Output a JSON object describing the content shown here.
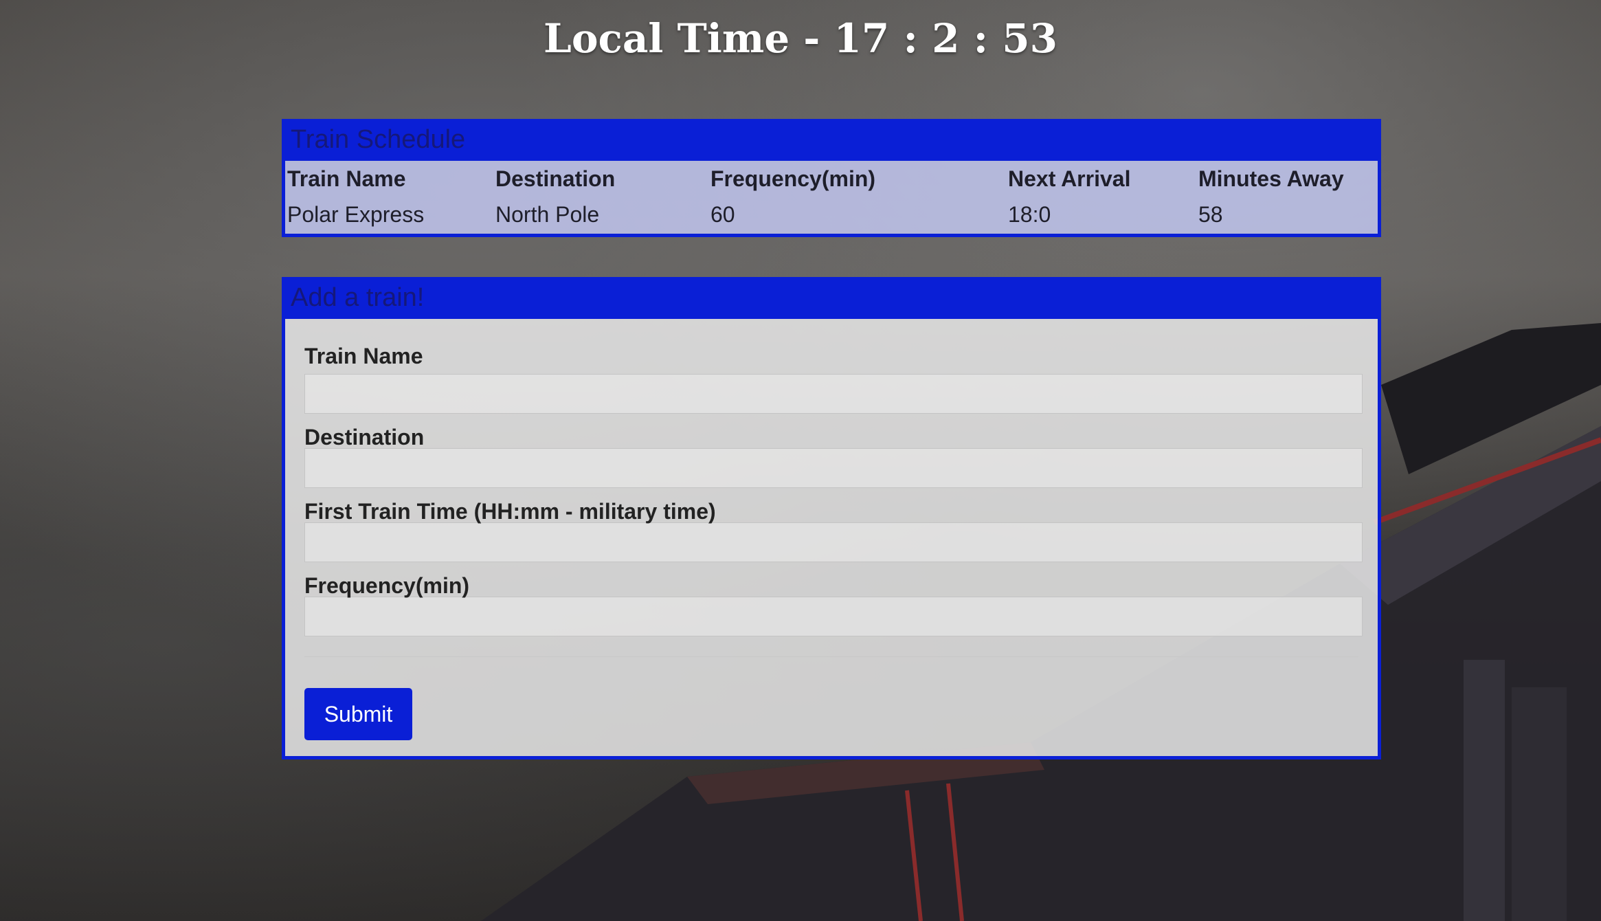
{
  "clock": {
    "text": "Local Time - 17 : 2 : 53"
  },
  "schedule": {
    "heading": "Train Schedule",
    "columns": [
      "Train Name",
      "Destination",
      "Frequency(min)",
      "Next Arrival",
      "Minutes Away"
    ],
    "rows": [
      [
        "Polar Express",
        "North Pole",
        "60",
        "18:0",
        "58"
      ]
    ]
  },
  "add_train": {
    "heading": "Add a train!",
    "fields": {
      "train_name": {
        "label": "Train Name",
        "value": ""
      },
      "destination": {
        "label": "Destination",
        "value": ""
      },
      "first_train_time": {
        "label": "First Train Time (HH:mm - military time)",
        "value": ""
      },
      "frequency": {
        "label": "Frequency(min)",
        "value": ""
      }
    },
    "submit_label": "Submit"
  },
  "colors": {
    "accent": "#0a1fd6",
    "heading_text": "#15187a"
  }
}
